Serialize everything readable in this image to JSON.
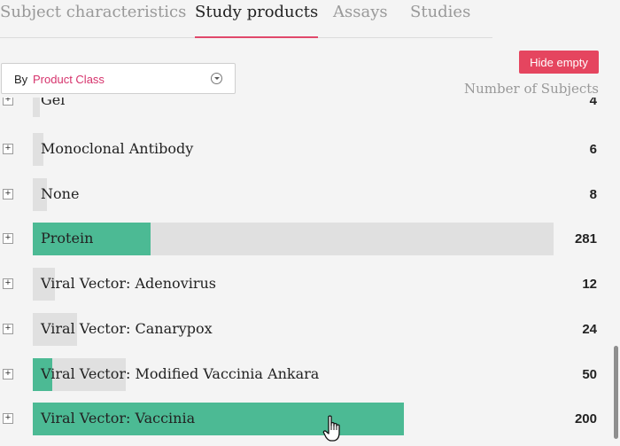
{
  "tabs": [
    {
      "label": "Subject characteristics"
    },
    {
      "label": "Study products"
    },
    {
      "label": "Assays"
    },
    {
      "label": "Studies"
    }
  ],
  "dropdown": {
    "prefix": "By",
    "value": "Product Class"
  },
  "hide_empty_label": "Hide empty",
  "column_header": "Number of Subjects",
  "rows": [
    {
      "label": "Gel",
      "count": "4",
      "bg_fraction": 0.014,
      "fg_fraction": 0
    },
    {
      "label": "Monoclonal Antibody",
      "count": "6",
      "bg_fraction": 0.021,
      "fg_fraction": 0
    },
    {
      "label": "None",
      "count": "8",
      "bg_fraction": 0.028,
      "fg_fraction": 0
    },
    {
      "label": "Protein",
      "count": "281",
      "bg_fraction": 1.0,
      "fg_fraction": 0.227
    },
    {
      "label": "Viral Vector: Adenovirus",
      "count": "12",
      "bg_fraction": 0.043,
      "fg_fraction": 0
    },
    {
      "label": "Viral Vector: Canarypox",
      "count": "24",
      "bg_fraction": 0.085,
      "fg_fraction": 0
    },
    {
      "label": "Viral Vector: Modified Vaccinia Ankara",
      "count": "50",
      "bg_fraction": 0.178,
      "fg_fraction": 0.037
    },
    {
      "label": "Viral Vector: Vaccinia",
      "count": "200",
      "bg_fraction": 0.712,
      "fg_fraction": 0.712
    }
  ],
  "colors": {
    "accent": "#e0486b",
    "bar_fill": "#4cba94",
    "bar_track": "#e0e0e0",
    "button": "#e5455f"
  }
}
